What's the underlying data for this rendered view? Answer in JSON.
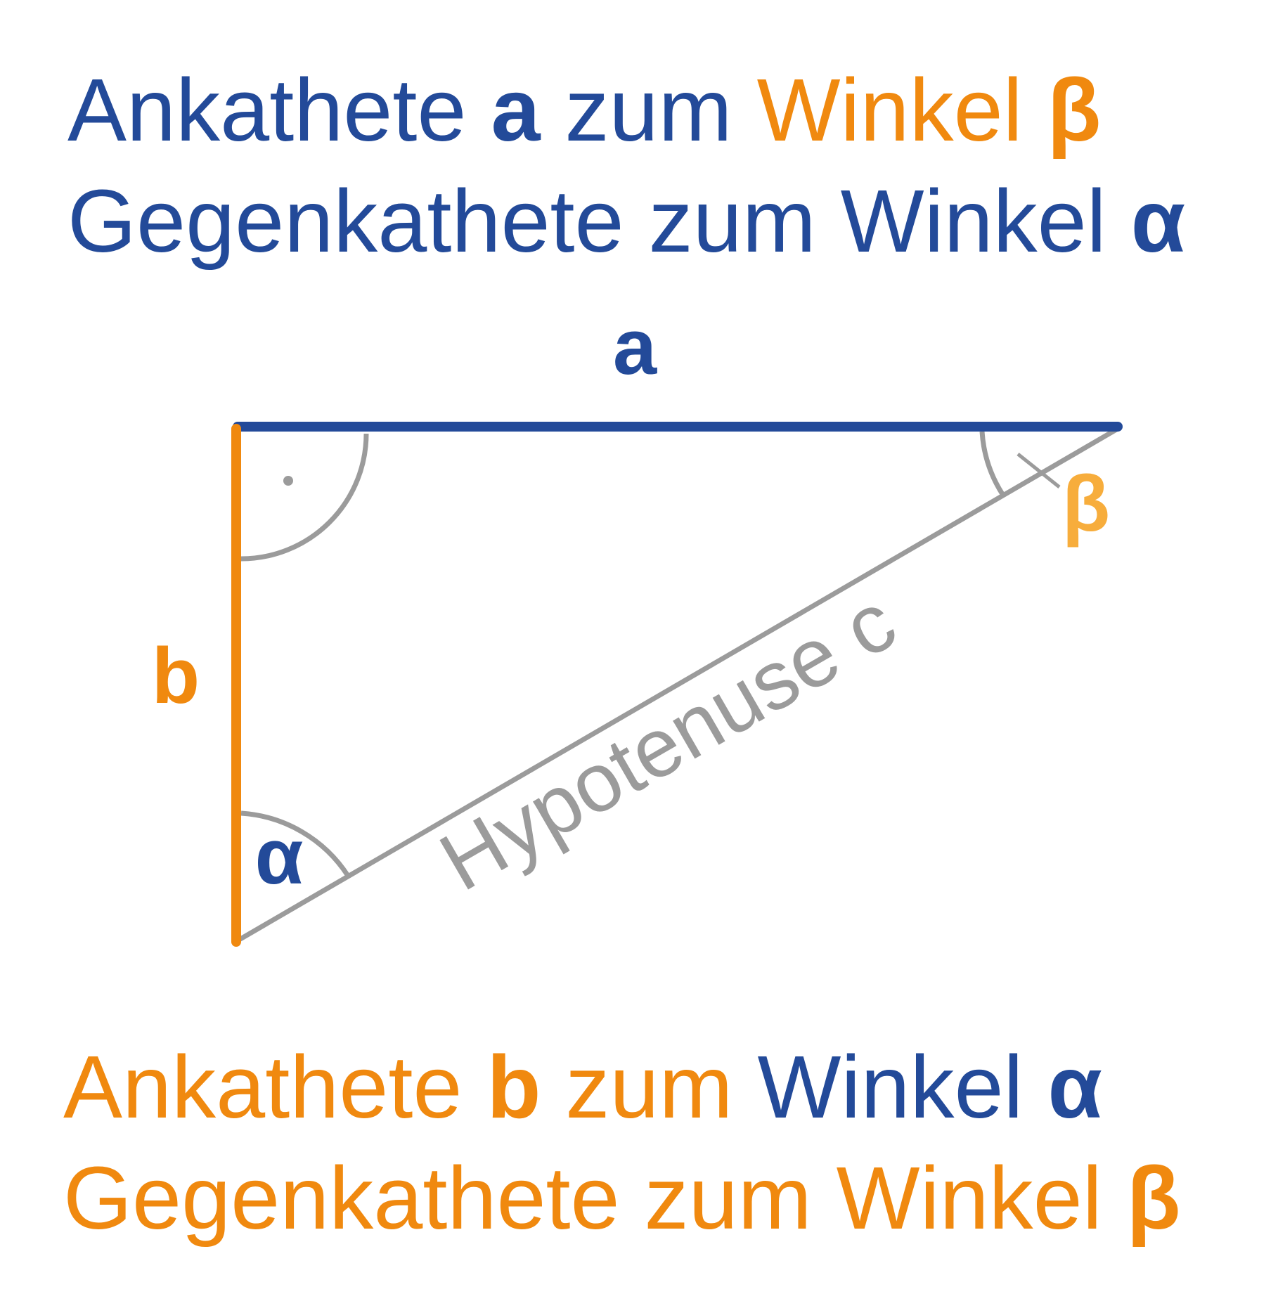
{
  "colors": {
    "blue": "#234a99",
    "orange": "#f0890f",
    "beta_label": "#f7ad3c",
    "gray": "#9b9b9b",
    "background": "#ffffff"
  },
  "top_caption": {
    "line1": [
      {
        "text": "Ankathete ",
        "color": "blue",
        "bold": false
      },
      {
        "text": "a",
        "color": "blue",
        "bold": true
      },
      {
        "text": " zum ",
        "color": "blue",
        "bold": false
      },
      {
        "text": "Winkel ",
        "color": "orange",
        "bold": false
      },
      {
        "text": "β",
        "color": "orange",
        "bold": true
      }
    ],
    "line2": [
      {
        "text": "Gegenkathete zum Winkel ",
        "color": "blue",
        "bold": false
      },
      {
        "text": "α",
        "color": "blue",
        "bold": true
      }
    ]
  },
  "bottom_caption": {
    "line1": [
      {
        "text": "Ankathete ",
        "color": "orange",
        "bold": false
      },
      {
        "text": "b",
        "color": "orange",
        "bold": true
      },
      {
        "text": " zum ",
        "color": "orange",
        "bold": false
      },
      {
        "text": "Winkel ",
        "color": "blue",
        "bold": false
      },
      {
        "text": "α",
        "color": "blue",
        "bold": true
      }
    ],
    "line2": [
      {
        "text": "Gegenkathete zum Winkel ",
        "color": "orange",
        "bold": false
      },
      {
        "text": "β",
        "color": "orange",
        "bold": true
      }
    ]
  },
  "triangle": {
    "side_a_label": "a",
    "side_b_label": "b",
    "hypotenuse_label": "Hypotenuse c",
    "angle_alpha_label": "α",
    "angle_beta_label": "β",
    "right_angle_marker": "·"
  }
}
